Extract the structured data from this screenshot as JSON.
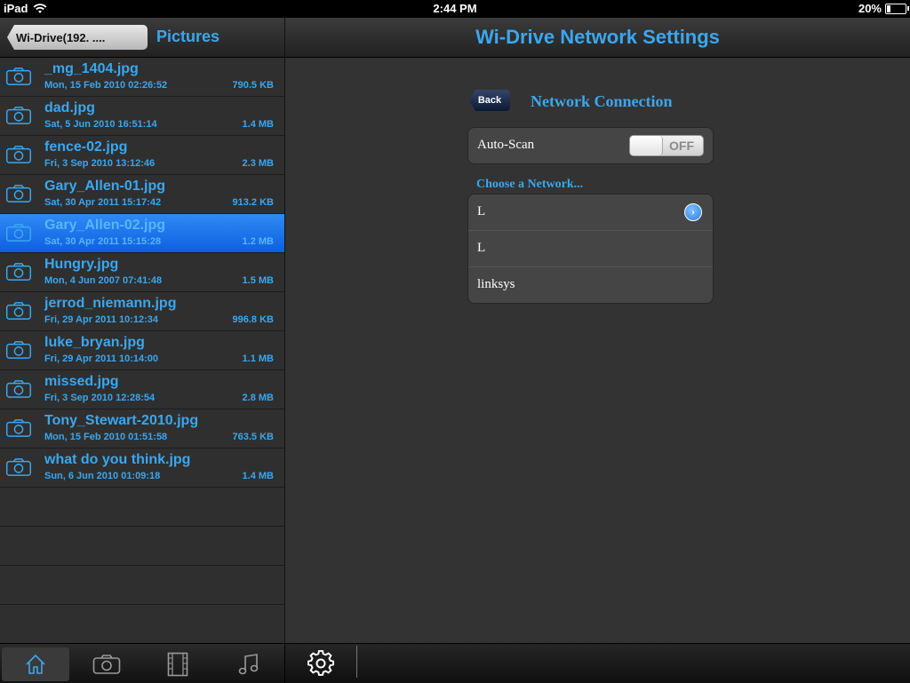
{
  "status_bar": {
    "device": "iPad",
    "time": "2:44 PM",
    "battery": "20%",
    "battery_level": 0.2
  },
  "left_panel": {
    "back_label": "Wi-Drive(192.        ....",
    "title": "Pictures",
    "files": [
      {
        "name": "_mg_1404.jpg",
        "date": "Mon, 15 Feb 2010 02:26:52",
        "size": "790.5 KB",
        "icon": "camera-icon"
      },
      {
        "name": "dad.jpg",
        "date": "Sat, 5 Jun 2010 16:51:14",
        "size": "1.4 MB",
        "icon": "camera-icon"
      },
      {
        "name": "fence-02.jpg",
        "date": "Fri, 3 Sep 2010 13:12:46",
        "size": "2.3 MB",
        "icon": "camera-icon"
      },
      {
        "name": "Gary_Allen-01.jpg",
        "date": "Sat, 30 Apr 2011 15:17:42",
        "size": "913.2 KB",
        "icon": "camera-icon"
      },
      {
        "name": "Gary_Allen-02.jpg",
        "date": "Sat, 30 Apr 2011 15:15:28",
        "size": "1.2 MB",
        "icon": "camera-icon",
        "selected": true
      },
      {
        "name": "Hungry.jpg",
        "date": "Mon, 4 Jun 2007 07:41:48",
        "size": "1.5 MB",
        "icon": "camera-icon"
      },
      {
        "name": "jerrod_niemann.jpg",
        "date": "Fri, 29 Apr 2011 10:12:34",
        "size": "996.8 KB",
        "icon": "camera-icon"
      },
      {
        "name": "luke_bryan.jpg",
        "date": "Fri, 29 Apr 2011 10:14:00",
        "size": "1.1 MB",
        "icon": "camera-icon"
      },
      {
        "name": "missed.jpg",
        "date": "Fri, 3 Sep 2010 12:28:54",
        "size": "2.8 MB",
        "icon": "camera-icon"
      },
      {
        "name": "Tony_Stewart-2010.jpg",
        "date": "Mon, 15 Feb 2010 01:51:58",
        "size": "763.5 KB",
        "icon": "camera-icon"
      },
      {
        "name": "what do you think.jpg",
        "date": "Sun, 6 Jun 2010 01:09:18",
        "size": "1.4 MB",
        "icon": "camera-icon"
      }
    ]
  },
  "right_panel": {
    "title": "Wi-Drive Network Settings",
    "back_label": "Back",
    "section_title": "Network Connection",
    "auto_scan_label": "Auto-Scan",
    "auto_scan_state": "OFF",
    "choose_label": "Choose a Network...",
    "networks": [
      {
        "name": "L",
        "has_disclosure": true
      },
      {
        "name": "L",
        "has_disclosure": false
      },
      {
        "name": "linksys",
        "has_disclosure": false
      }
    ]
  },
  "tabbar": {
    "tabs": [
      {
        "icon": "home-icon",
        "active": true
      },
      {
        "icon": "camera-icon",
        "active": false
      },
      {
        "icon": "film-icon",
        "active": false
      },
      {
        "icon": "music-icon",
        "active": false
      }
    ]
  },
  "toolbar": {
    "settings_icon": "gear-icon"
  },
  "colors": {
    "accent": "#3aa7f0",
    "selection": "#1f78ec"
  }
}
